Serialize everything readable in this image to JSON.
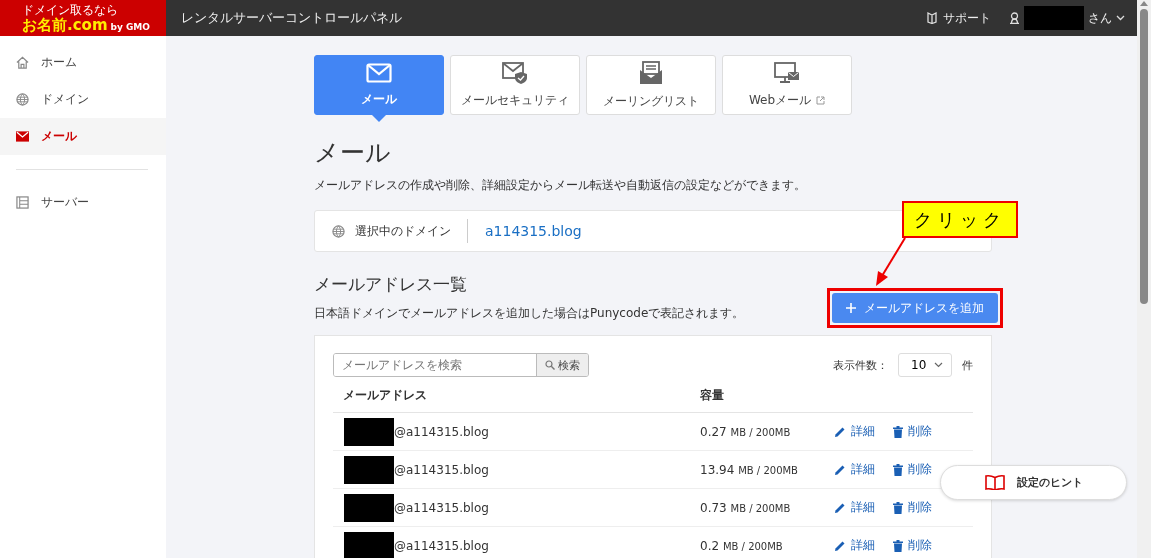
{
  "header": {
    "logo": {
      "tagline": "ドメイン取るなら",
      "name": "お名前.com",
      "suffix": "by GMO"
    },
    "title": "レンタルサーバーコントロールパネル",
    "support": "サポート",
    "user_suffix": "さん"
  },
  "sidebar": {
    "groups": [
      [
        {
          "label": "ホーム",
          "kind": "home",
          "selected": false
        },
        {
          "label": "ドメイン",
          "kind": "globe",
          "selected": false
        },
        {
          "label": "メール",
          "kind": "mail",
          "selected": true
        }
      ],
      [
        {
          "label": "サーバー",
          "kind": "server",
          "selected": false
        }
      ]
    ]
  },
  "tabs": [
    {
      "label": "メール",
      "kind": "mail",
      "selected": true,
      "external": false
    },
    {
      "label": "メールセキュリティ",
      "kind": "security",
      "selected": false,
      "external": false
    },
    {
      "label": "メーリングリスト",
      "kind": "list",
      "selected": false,
      "external": false
    },
    {
      "label": "Webメール",
      "kind": "webmail",
      "selected": false,
      "external": true
    }
  ],
  "page": {
    "title": "メール",
    "description": "メールアドレスの作成や削除、詳細設定からメール転送や自動返信の設定などができます。"
  },
  "domain": {
    "label": "選択中のドメイン",
    "value": "a114315.blog"
  },
  "section": {
    "title": "メールアドレス一覧",
    "note": "日本語ドメインでメールアドレスを追加した場合はPunycodeで表記されます。",
    "add_button": "メールアドレスを追加"
  },
  "table": {
    "search": {
      "placeholder": "メールアドレスを検索",
      "button": "検索"
    },
    "per_page": {
      "label": "表示件数：",
      "value": "10",
      "suffix": "件"
    },
    "columns": [
      "メールアドレス",
      "容量"
    ],
    "rows": [
      {
        "address": "@a114315.blog",
        "used": "0.27",
        "quota": "MB / 200MB",
        "edit": "詳細",
        "delete": "削除"
      },
      {
        "address": "@a114315.blog",
        "used": "13.94",
        "quota": "MB / 200MB",
        "edit": "詳細",
        "delete": "削除"
      },
      {
        "address": "@a114315.blog",
        "used": "0.73",
        "quota": "MB / 200MB",
        "edit": "詳細",
        "delete": "削除"
      },
      {
        "address": "@a114315.blog",
        "used": "0.2",
        "quota": "MB / 200MB",
        "edit": "詳細",
        "delete": "削除"
      }
    ]
  },
  "hint_button": "設定のヒント",
  "annotation": {
    "text": "クリック"
  }
}
